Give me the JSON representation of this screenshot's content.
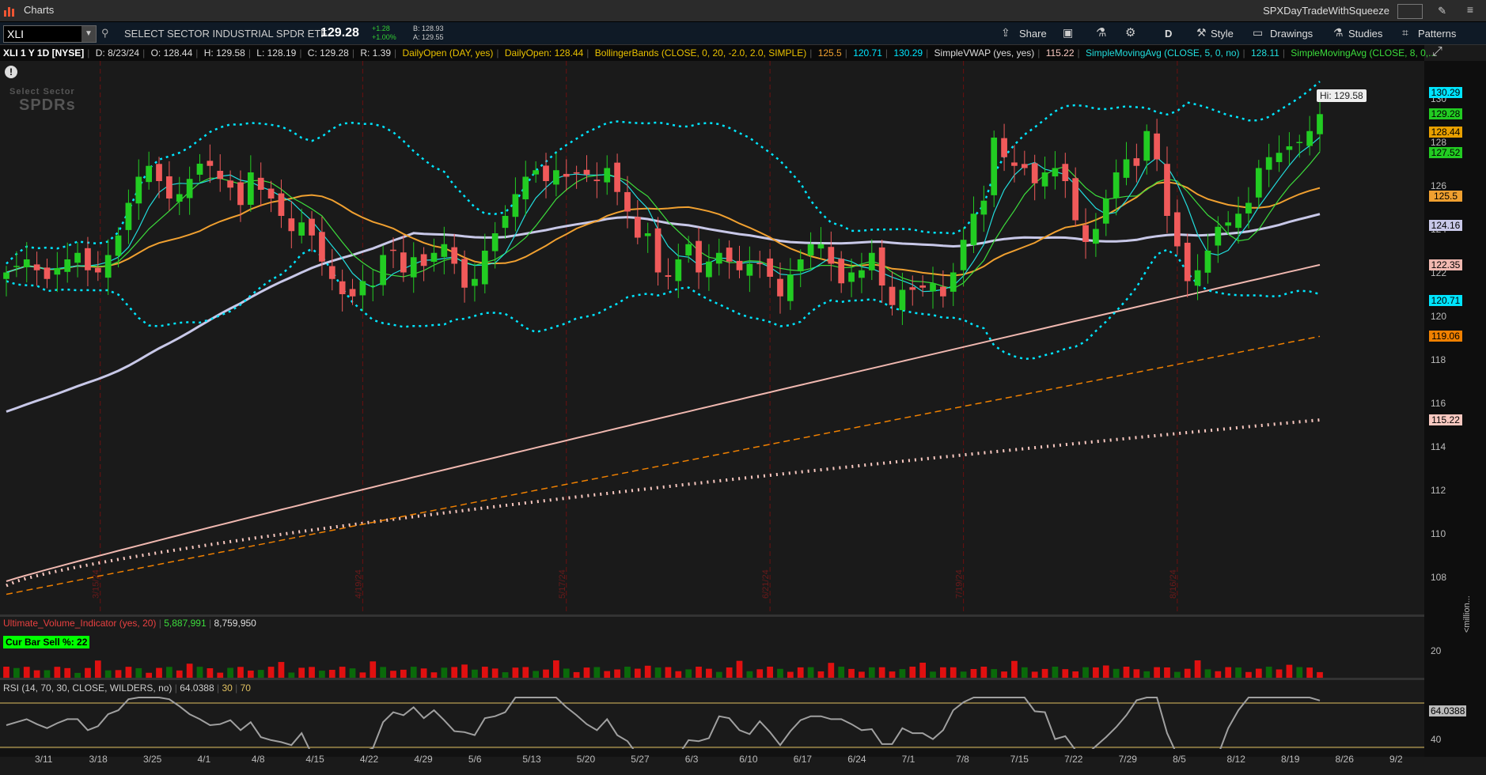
{
  "window": {
    "app_title": "Charts",
    "workspace_name": "SPXDayTradeWithSqueeze"
  },
  "toolbar": {
    "symbol": "XLI",
    "description": "SELECT SECTOR INDUSTRIAL SPDR ETF",
    "last": "129.28",
    "change": "+1.28",
    "change_pct": "+1.00%",
    "bid": "B: 128.93",
    "ask": "A: 129.55",
    "buttons": {
      "share": "Share",
      "period": "D",
      "style": "Style",
      "drawings": "Drawings",
      "studies": "Studies",
      "patterns": "Patterns"
    }
  },
  "info": {
    "title": "XLI 1 Y 1D [NYSE]",
    "date": "D: 8/23/24",
    "open": "O: 128.44",
    "high": "H: 129.58",
    "low": "L: 128.19",
    "close": "C: 129.28",
    "range": "R: 1.39",
    "study1": "DailyOpen (DAY, yes)",
    "study1_val": "DailyOpen: 128.44",
    "study2": "BollingerBands (CLOSE, 0, 20, -2.0, 2.0, SIMPLE)",
    "study2_v1": "125.5",
    "study2_v2": "120.71",
    "study2_v3": "130.29",
    "study3": "SimpleVWAP (yes, yes)",
    "study3_val": "115.22",
    "study4": "SimpleMovingAvg (CLOSE, 5, 0, no)",
    "study4_val": "128.11",
    "study5": "SimpleMovingAvg (CLOSE, 8, 0,..."
  },
  "logo": {
    "line1": "Select Sector",
    "line2": "SPDRs"
  },
  "hi_label": "Hi: 129.58",
  "price_badges": [
    {
      "label": "130.29",
      "value": 130.29,
      "color": "#00e5ff"
    },
    {
      "label": "129.28",
      "value": 129.28,
      "color": "#22cc22"
    },
    {
      "label": "128.44",
      "value": 128.44,
      "color": "#e8a000"
    },
    {
      "label": "127.52",
      "value": 127.52,
      "color": "#22cc22"
    },
    {
      "label": "125.5",
      "value": 125.5,
      "color": "#f0a030"
    },
    {
      "label": "124.16",
      "value": 124.16,
      "color": "#c8c8e8"
    },
    {
      "label": "122.35",
      "value": 122.35,
      "color": "#f0b8b0"
    },
    {
      "label": "120.71",
      "value": 120.71,
      "color": "#00e5ff"
    },
    {
      "label": "119.06",
      "value": 119.06,
      "color": "#f08000"
    },
    {
      "label": "115.22",
      "value": 115.22,
      "color": "#f8c8c0"
    }
  ],
  "price_ticks": [
    "130",
    "128",
    "126",
    "124",
    "122",
    "120",
    "118",
    "116",
    "114",
    "112",
    "110",
    "108"
  ],
  "volume": {
    "title": "Ultimate_Volume_Indicator (yes, 20)",
    "val1": "5,887,991",
    "val2": "8,759,950",
    "cur_bar": "Cur Bar Sell %: 22",
    "tick": "20",
    "unit": "<million..."
  },
  "rsi": {
    "title": "RSI (14, 70, 30, CLOSE, WILDERS, no)",
    "value": "64.0388",
    "low": "30",
    "high": "70",
    "badge": "64.0388",
    "tick": "40"
  },
  "chart_data": {
    "type": "candlestick",
    "title": "XLI 1 Y 1D [NYSE]",
    "ylim": [
      107,
      131
    ],
    "x_tick_labels": [
      "3/11",
      "3/18",
      "3/25",
      "4/1",
      "4/8",
      "4/15",
      "4/22",
      "4/29",
      "5/6",
      "5/13",
      "5/20",
      "5/27",
      "6/3",
      "6/10",
      "6/17",
      "6/24",
      "7/1",
      "7/8",
      "7/15",
      "7/22",
      "7/29",
      "8/5",
      "8/12",
      "8/19",
      "8/26",
      "9/2"
    ],
    "expiration_markers": [
      "3/15/24",
      "4/19/24",
      "5/17/24",
      "6/21/24",
      "7/19/24",
      "8/16/24"
    ],
    "series": [
      {
        "name": "Close",
        "values": [
          122.0,
          122.3,
          122.6,
          122.1,
          121.7,
          122.2,
          122.6,
          122.9,
          122.1,
          122.0,
          122.8,
          123.7,
          125.2,
          126.4,
          126.9,
          126.2,
          125.4,
          125.6,
          126.3,
          127.0,
          126.9,
          126.3,
          125.9,
          125.1,
          126.6,
          125.8,
          125.4,
          124.6,
          123.9,
          124.3,
          123.7,
          122.5,
          121.7,
          121.0,
          120.9,
          121.6,
          121.4,
          122.8,
          123.0,
          122.0,
          122.7,
          122.3,
          122.9,
          123.3,
          122.4,
          121.3,
          121.7,
          123.0,
          123.8,
          124.6,
          125.6,
          126.4,
          126.7,
          126.2,
          126.7,
          126.4,
          126.6,
          126.5,
          126.2,
          126.8,
          125.7,
          124.8,
          123.6,
          123.8,
          122.0,
          121.8,
          122.6,
          123.3,
          122.0,
          122.5,
          122.9,
          122.5,
          122.1,
          122.4,
          122.4,
          121.8,
          120.9,
          121.9,
          122.6,
          123.3,
          123.3,
          122.4,
          121.5,
          122.0,
          122.1,
          122.9,
          121.4,
          120.5,
          121.2,
          121.2,
          121.3,
          121.5,
          120.9,
          122.0,
          123.5,
          124.7,
          125.3,
          128.2,
          127.3,
          126.9,
          126.8,
          126.1,
          126.6,
          126.8,
          126.2,
          124.4,
          123.4,
          124.0,
          125.4,
          126.6,
          127.2,
          126.9,
          128.5,
          127.2,
          124.6,
          123.2,
          121.6,
          122.1,
          123.0,
          124.1,
          124.3,
          124.7,
          125.2,
          126.8,
          127.3,
          127.5,
          127.8,
          128.0,
          128.5,
          129.28
        ]
      },
      {
        "name": "BollingerBands Upper",
        "values": [
          124.16,
          130.29
        ]
      },
      {
        "name": "BollingerBands Lower",
        "values": [
          120.71
        ]
      },
      {
        "name": "SimpleVWAP",
        "values": [
          115.22
        ]
      },
      {
        "name": "SimpleMovingAvg (CLOSE, 5)",
        "values": [
          128.11
        ]
      }
    ]
  }
}
